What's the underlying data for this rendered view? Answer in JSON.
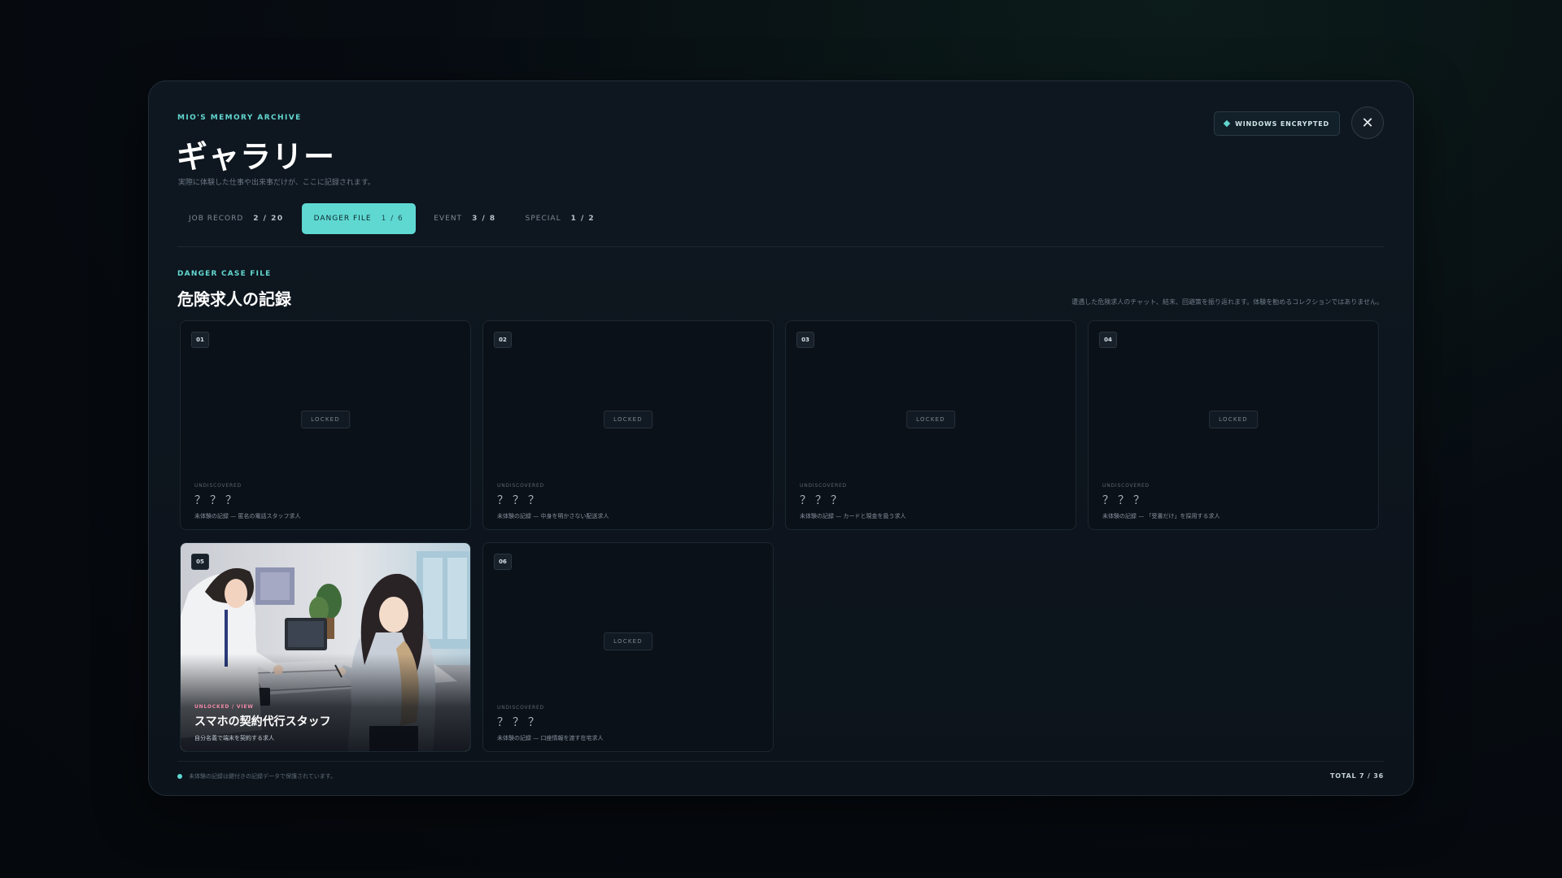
{
  "header": {
    "eyebrow": "MIO'S MEMORY ARCHIVE",
    "title": "ギャラリー",
    "subtitle": "実際に体験した仕事や出来事だけが、ここに記録されます。",
    "badge": "WINDOWS ENCRYPTED",
    "close_icon": "close-icon",
    "close_glyph": "✕"
  },
  "tabs": [
    {
      "label": "JOB RECORD",
      "count": "2 / 20",
      "active": false
    },
    {
      "label": "DANGER FILE",
      "count": "1 / 6",
      "active": true
    },
    {
      "label": "EVENT",
      "count": "3 / 8",
      "active": false
    },
    {
      "label": "SPECIAL",
      "count": "1 / 2",
      "active": false
    }
  ],
  "section": {
    "eyebrow": "DANGER CASE FILE",
    "title": "危険求人の記録",
    "note": "遭遇した危険求人のチャット、結末、回避策を振り返れます。体験を勧めるコレクションではありません。"
  },
  "cards": [
    {
      "num": "01",
      "locked": true,
      "lock_label": "LOCKED",
      "state": "UNDISCOVERED",
      "name": "？？？",
      "hint": "未体験の記録 — 匿名の電話スタッフ求人"
    },
    {
      "num": "02",
      "locked": true,
      "lock_label": "LOCKED",
      "state": "UNDISCOVERED",
      "name": "？？？",
      "hint": "未体験の記録 — 中身を明かさない配送求人"
    },
    {
      "num": "03",
      "locked": true,
      "lock_label": "LOCKED",
      "state": "UNDISCOVERED",
      "name": "？？？",
      "hint": "未体験の記録 — カードと現金を扱う求人"
    },
    {
      "num": "04",
      "locked": true,
      "lock_label": "LOCKED",
      "state": "UNDISCOVERED",
      "name": "？？？",
      "hint": "未体験の記録 — 「受書だけ」を採用する求人"
    },
    {
      "num": "05",
      "locked": false,
      "lock_label": "",
      "state": "UNLOCKED / VIEW",
      "name": "スマホの契約代行スタッフ",
      "hint": "自分名義で端末を契約する求人"
    },
    {
      "num": "06",
      "locked": true,
      "lock_label": "LOCKED",
      "state": "UNDISCOVERED",
      "name": "？？？",
      "hint": "未体験の記録 — 口座情報を渡す在宅求人"
    }
  ],
  "footer": {
    "note": "未体験の記録は鍵付きの記録データで保護されています。",
    "total": "TOTAL 7 / 36"
  },
  "colors": {
    "accent": "#5fd8d2",
    "unlocked_state": "#f08aa6",
    "panel_bg": "#0e1720"
  }
}
